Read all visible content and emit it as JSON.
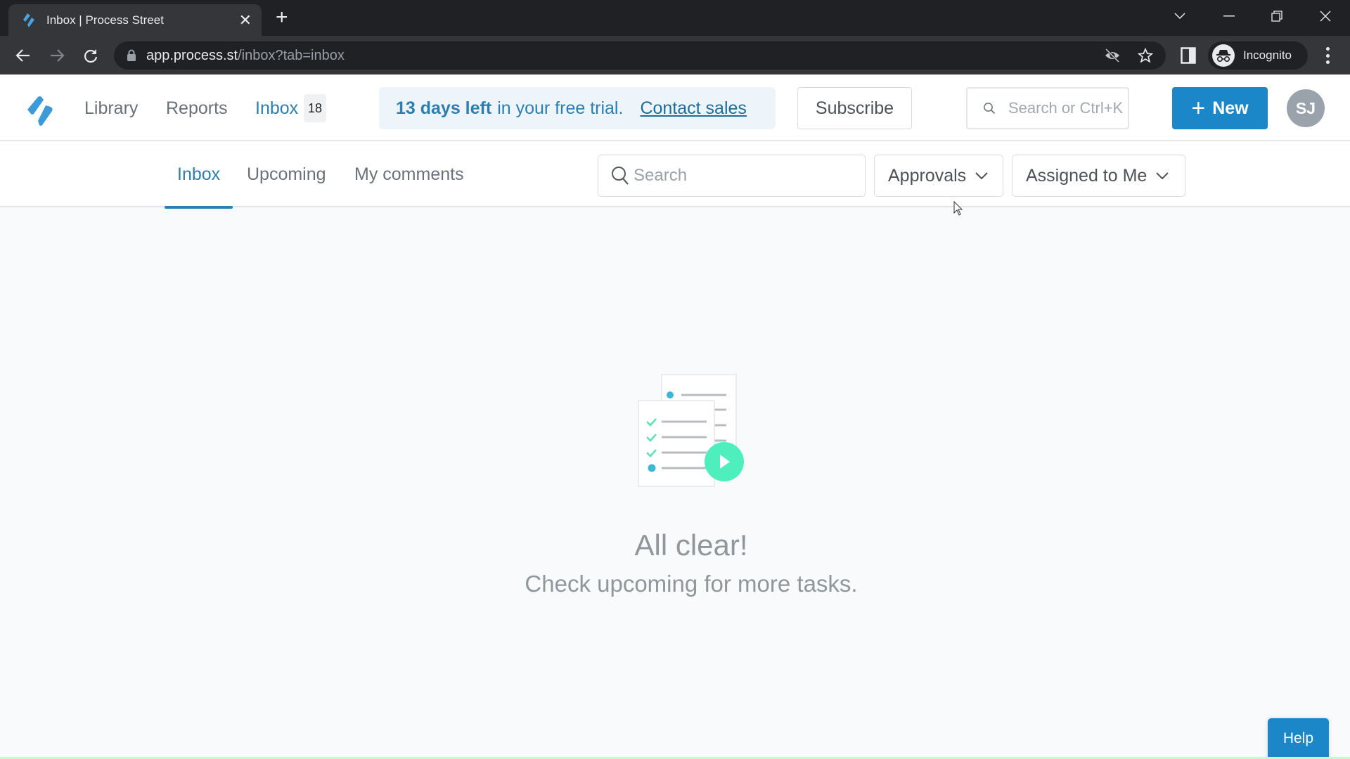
{
  "browser": {
    "tab_title": "Inbox | Process Street",
    "url_host": "app.process.st",
    "url_path": "/inbox?tab=inbox",
    "profile_label": "Incognito"
  },
  "header": {
    "nav": [
      {
        "label": "Library",
        "active": false
      },
      {
        "label": "Reports",
        "active": false
      },
      {
        "label": "Inbox",
        "active": true
      }
    ],
    "inbox_count": "18",
    "trial": {
      "days_left": "13 days left",
      "rest": "in your free trial.",
      "contact_label": "Contact sales"
    },
    "subscribe_label": "Subscribe",
    "search_placeholder": "Search or Ctrl+K",
    "new_label": "New",
    "avatar_initials": "SJ"
  },
  "subtabs": {
    "tabs": [
      {
        "label": "Inbox",
        "active": true
      },
      {
        "label": "Upcoming",
        "active": false
      },
      {
        "label": "My comments",
        "active": false
      }
    ],
    "search_placeholder": "Search",
    "filter_type": "Approvals",
    "filter_assignee": "Assigned to Me"
  },
  "empty_state": {
    "title": "All clear!",
    "subtitle": "Check upcoming for more tasks."
  },
  "help_label": "Help",
  "colors": {
    "brand": "#1b87c9",
    "link": "#2b7fb0",
    "accent_green": "#4eeebd",
    "dot_blue": "#3bb7d9"
  }
}
